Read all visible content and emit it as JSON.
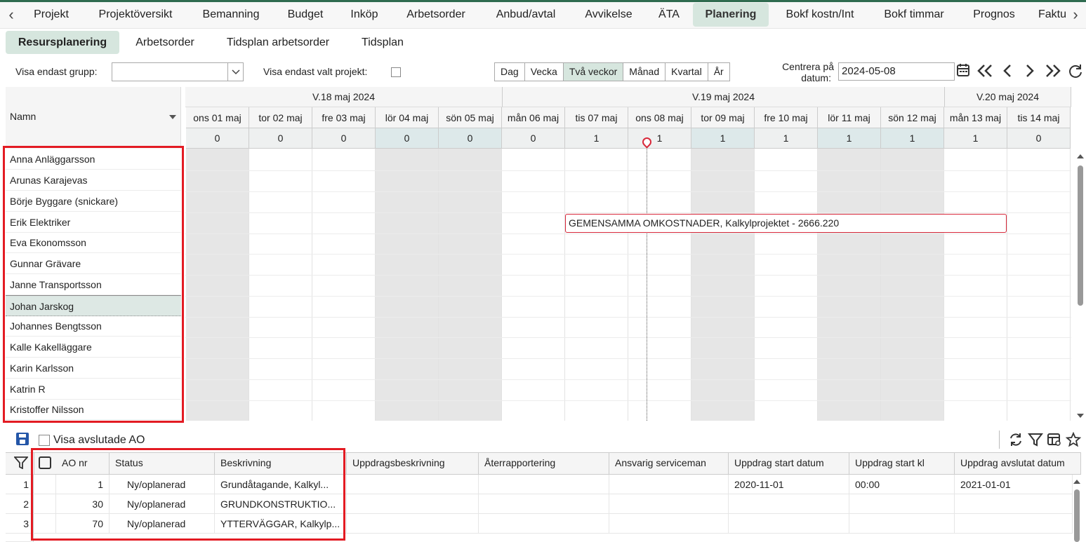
{
  "main_tabs": [
    "Projekt",
    "Projektöversikt",
    "Bemanning",
    "Budget",
    "Inköp",
    "Arbetsorder",
    "Anbud/avtal",
    "Avvikelse",
    "ÄTA",
    "Planering",
    "Bokf kostn/Int",
    "Bokf timmar",
    "Prognos",
    "Faktu"
  ],
  "active_main_tab": "Planering",
  "sub_tabs": [
    "Resursplanering",
    "Arbetsorder",
    "Tidsplan arbetsorder",
    "Tidsplan"
  ],
  "active_sub_tab": "Resursplanering",
  "filters": {
    "group_label": "Visa endast grupp:",
    "group_value": "",
    "project_label": "Visa endast valt projekt:",
    "project_checked": false
  },
  "view_modes": [
    "Dag",
    "Vecka",
    "Två veckor",
    "Månad",
    "Kvartal",
    "År"
  ],
  "active_view_mode": "Två veckor",
  "center_date": {
    "label_line1": "Centrera på",
    "label_line2": "datum:",
    "value": "2024-05-08"
  },
  "scheduler": {
    "name_column_header": "Namn",
    "weeks": [
      "V.18 maj 2024",
      "V.19 maj 2024",
      "V.20 maj 2024"
    ],
    "days": [
      "ons 01 maj",
      "tor 02 maj",
      "fre 03 maj",
      "lör 04 maj",
      "sön 05 maj",
      "mån 06 maj",
      "tis 07 maj",
      "ons 08 maj",
      "tor 09 maj",
      "fre 10 maj",
      "lör 11 maj",
      "sön 12 maj",
      "mån 13 maj",
      "tis 14 maj"
    ],
    "counts": [
      "0",
      "0",
      "0",
      "0",
      "0",
      "0",
      "1",
      "1",
      "1",
      "1",
      "1",
      "1",
      "1",
      "0"
    ],
    "resources": [
      "Anna Anläggarsson",
      "Arunas Karajevas",
      "Börje Byggare (snickare)",
      "Erik Elektriker",
      "Eva Ekonomsson",
      "Gunnar Grävare",
      "Janne Transportsson",
      "Johan Jarskog",
      "Johannes Bengtsson",
      "Kalle Kakelläggare",
      "Karin Karlsson",
      "Katrin R",
      "Kristoffer Nilsson"
    ],
    "selected_resource": "Johan Jarskog",
    "task_bar_text": "GEMENSAMMA OMKOSTNADER, Kalkylprojektet - 2666.220"
  },
  "bottom": {
    "show_closed_label": "Visa avslutade AO",
    "show_closed_checked": false,
    "columns": [
      "AO nr",
      "Status",
      "Beskrivning",
      "Uppdragsbeskrivning",
      "Återrapportering",
      "Ansvarig serviceman",
      "Uppdrag start datum",
      "Uppdrag start kl",
      "Uppdrag avslutat datum"
    ],
    "rows": [
      {
        "num": "1",
        "ao": "1",
        "status": "Ny/oplanerad",
        "desc": "Grundåtagande, Kalkyl...",
        "start_date": "2020-11-01",
        "start_time": "00:00",
        "end_date": "2021-01-01"
      },
      {
        "num": "2",
        "ao": "30",
        "status": "Ny/oplanerad",
        "desc": "GRUNDKONSTRUKTIO...",
        "start_date": "",
        "start_time": "",
        "end_date": ""
      },
      {
        "num": "3",
        "ao": "70",
        "status": "Ny/oplanerad",
        "desc": "YTTERVÄGGAR, Kalkylp...",
        "start_date": "",
        "start_time": "",
        "end_date": ""
      }
    ]
  },
  "colors": {
    "accent": "#d6e6de",
    "highlight_box": "#e31b23",
    "weekend": "#e6e6e6",
    "task_border": "#d8283a"
  }
}
